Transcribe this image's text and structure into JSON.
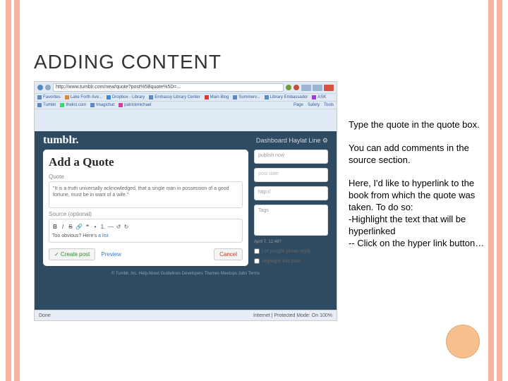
{
  "slide": {
    "title": "ADDING CONTENT"
  },
  "notes": {
    "p1": "Type the quote in the quote box.",
    "p2": "You can add comments in the source section.",
    "p3a": "Here, I'd like to hyperlink to the book from which the quote was taken. To do so:",
    "p3b": "-Highlight the text that will be hyperlinked",
    "p3c": "-- Click on the hyper link button…"
  },
  "browser": {
    "url": "http://www.tumblr.com/new/quote?post%5Bquote%5D=...",
    "window_buttons": [
      "min",
      "max",
      "close"
    ],
    "bookmarks": [
      "Favorites",
      "Lake Forth Ave...",
      "Dropbox - Library",
      "Embassy Library Center",
      "Main Blog",
      "Summerv...",
      "Library Embassador",
      "ASK"
    ],
    "toolbar2": [
      "Tumblr",
      "thelist.com",
      "Imagichat",
      "patrickmichael"
    ],
    "toolbar_right": [
      "Page",
      "Safety",
      "Tools"
    ]
  },
  "tumblr": {
    "logo": "tumblr.",
    "nav_right": "Dashboard   Haylat Line   ⚙",
    "panel_title": "Add a Quote",
    "quote_label": "Quote",
    "quote_text": "\"It is a truth universally acknowledged, that a single man in possession of a good fortune, must be in want of a wife.\"",
    "source_label": "Source (optional)",
    "toolbar_items": [
      "B",
      "I",
      "S",
      "🔗",
      "❝",
      "•",
      "1.",
      "—",
      "↺",
      "↻"
    ],
    "source_text_plain": "Too obvious? Here's ",
    "source_text_link": "a list",
    "create_label": "✓ Create post",
    "preview_label": "Preview",
    "cancel_label": "Cancel",
    "side": {
      "publish": "publish now",
      "publish_hint": "post date",
      "url": "http://",
      "tags": "Tags",
      "opt1_label": "Let people photo reply",
      "opt2_label": "Highlight this post"
    },
    "side_date": "April 7, 12:48?",
    "footer": "© Tumblr, Inc.   Help   About   Guidelines   Developers   Themes   Meetups   Jobs   Terms",
    "status_left": "Done",
    "status_right": "Internet | Protected Mode: On      100%"
  }
}
